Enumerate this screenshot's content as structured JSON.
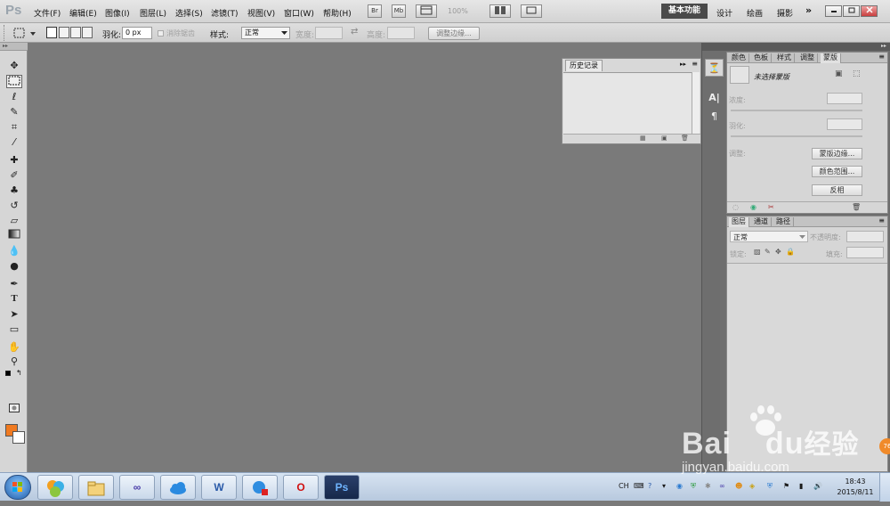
{
  "app": {
    "logo": "Ps"
  },
  "menus": [
    "文件(F)",
    "编辑(E)",
    "图像(I)",
    "图层(L)",
    "选择(S)",
    "滤镜(T)",
    "视图(V)",
    "窗口(W)",
    "帮助(H)"
  ],
  "menubar": {
    "bridge_label": "Br",
    "minibridge_label": "Mb",
    "zoom": "100%",
    "workspaces": {
      "active": "基本功能",
      "design": "设计",
      "painting": "绘画",
      "photography": "摄影",
      "more": "»"
    }
  },
  "options": {
    "feather_label": "羽化:",
    "feather_value": "0 px",
    "antialias_label": "消除锯齿",
    "style_label": "样式:",
    "style_value": "正常",
    "width_label": "宽度:",
    "height_label": "高度:",
    "refine_edge": "调整边缘..."
  },
  "history": {
    "tab": "历史记录"
  },
  "masks_panel": {
    "tabs": [
      "颜色",
      "色板",
      "样式",
      "调整",
      "蒙版"
    ],
    "status": "未选择蒙版",
    "density_label": "浓度:",
    "feather_label": "羽化:",
    "refine_label": "调整:",
    "mask_edge_btn": "蒙版边缘...",
    "color_range_btn": "颜色范围...",
    "invert_btn": "反相"
  },
  "layers_panel": {
    "tabs": [
      "图层",
      "通道",
      "路径"
    ],
    "blend_mode": "正常",
    "opacity_label": "不透明度:",
    "lock_label": "锁定:",
    "fill_label": "填充:"
  },
  "taskbar": {
    "lang": "CH",
    "clock_time": "18:43",
    "clock_date": "2015/8/11",
    "apps": [
      "windows-icon",
      "explorer-icon",
      "infinity-icon",
      "baidu-cloud-icon",
      "word-icon",
      "chat-icon",
      "opera-icon",
      "photoshop-icon"
    ]
  },
  "watermark": {
    "brand": "Bai",
    "brand2": "du",
    "cn": "经验",
    "url": "jingyan.baidu.com",
    "badge": "76"
  },
  "colors": {
    "foreground": "#f07a20",
    "background": "#ffffff",
    "canvas": "#7a7a7a",
    "workspace_active": "#4a4a4a"
  }
}
